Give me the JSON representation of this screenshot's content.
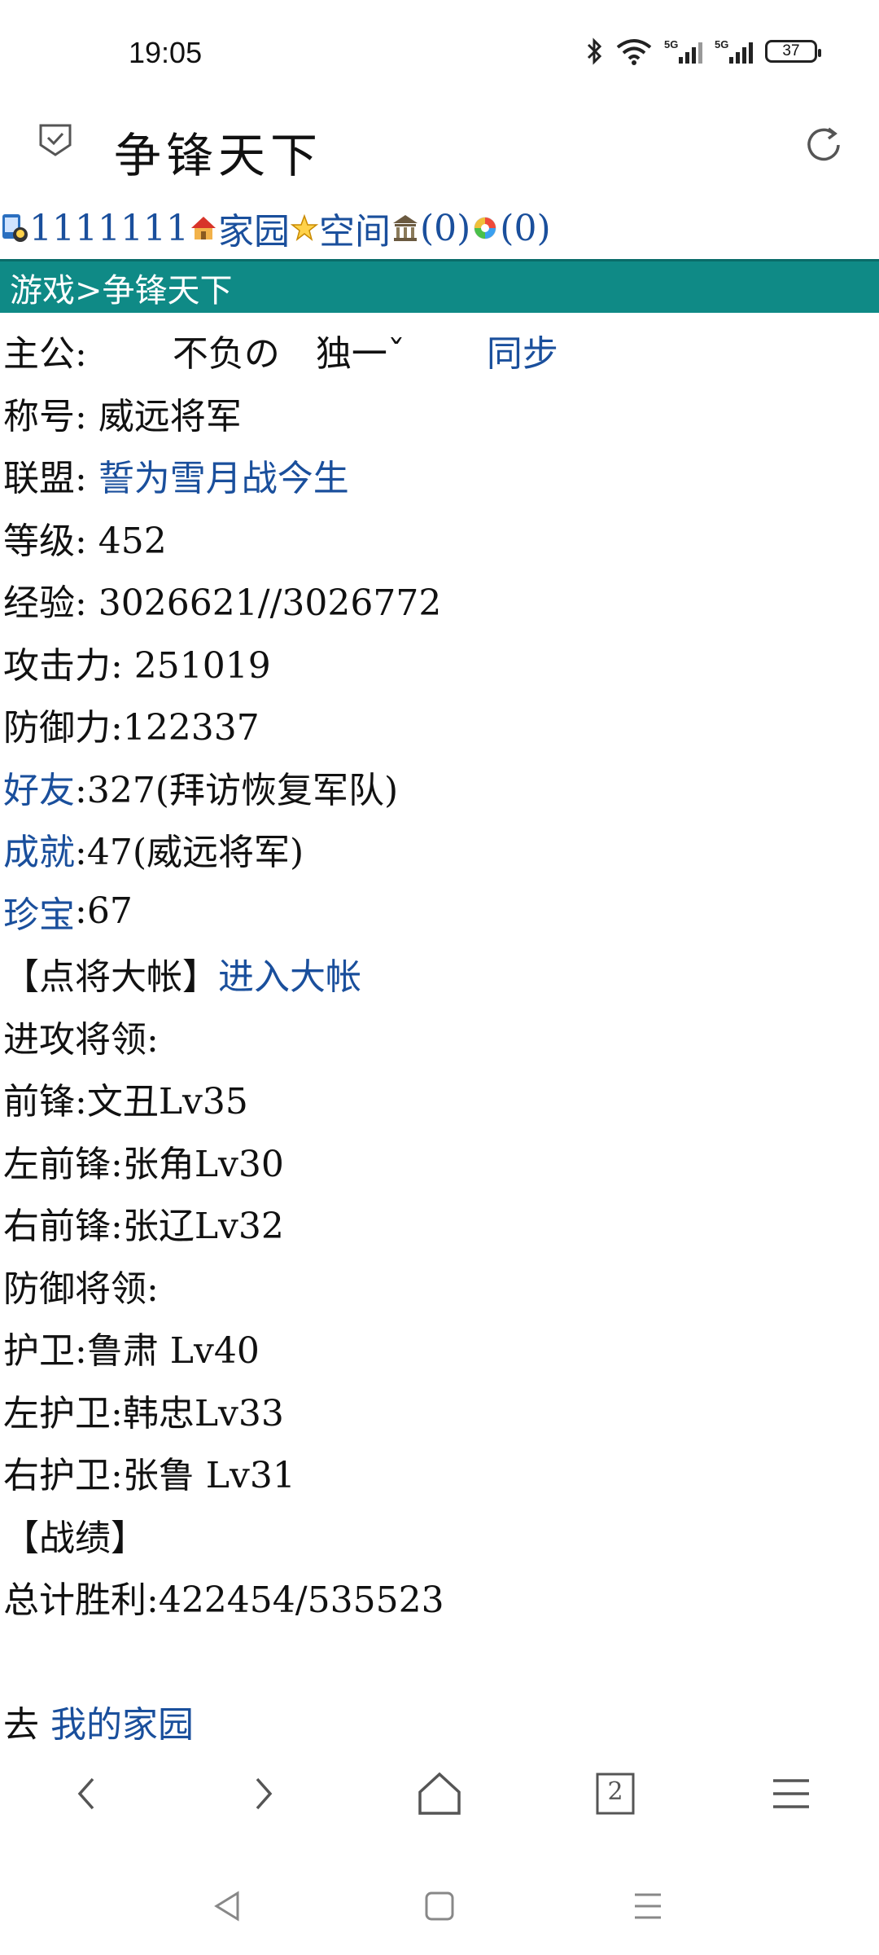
{
  "status_bar": {
    "time": "19:05",
    "battery": "37",
    "network_label_1": "5G",
    "network_label_2": "5G"
  },
  "header": {
    "title": "争锋天下"
  },
  "top_links": {
    "user_id": "1111111",
    "home": "家园",
    "space": "空间",
    "bank_count": "(0)",
    "photo_count": "(0)"
  },
  "breadcrumb": "游戏>争锋天下",
  "profile": {
    "lord_label": "主公:",
    "lord_name": "不负の　独一ˇ",
    "sync": "同步",
    "title_label": "称号: ",
    "title_value": "威远将军",
    "alliance_label": "联盟: ",
    "alliance_value": "誓为雪月战今生",
    "level_text": "等级: 452",
    "exp_text": "经验: 3026621//3026772",
    "attack_text": "攻击力: 251019",
    "defense_text": "防御力:122337",
    "friends_link": "好友",
    "friends_text": ":327(拜访恢复军队)",
    "achievement_link": "成就",
    "achievement_text": ":47(威远将军)",
    "treasure_link": "珍宝",
    "treasure_text": ":67",
    "camp_label": "【点将大帐】",
    "camp_link": "进入大帐",
    "attack_generals_label": "进攻将领:",
    "vanguard": "前锋:文丑Lv35",
    "left_vanguard": "左前锋:张角Lv30",
    "right_vanguard": "右前锋:张辽Lv32",
    "defense_generals_label": "防御将领:",
    "guard": "护卫:鲁肃 Lv40",
    "left_guard": "左护卫:韩忠Lv33",
    "right_guard": "右护卫:张鲁 Lv31",
    "record_label": "【战绩】",
    "total_wins": "总计胜利:422454/535523",
    "goto_label": "去 ",
    "my_home_link": "我的家园"
  },
  "browser_nav": {
    "tab_count": "2"
  },
  "colors": {
    "link": "#1a4f9c",
    "section_bar": "#0f8a86"
  }
}
